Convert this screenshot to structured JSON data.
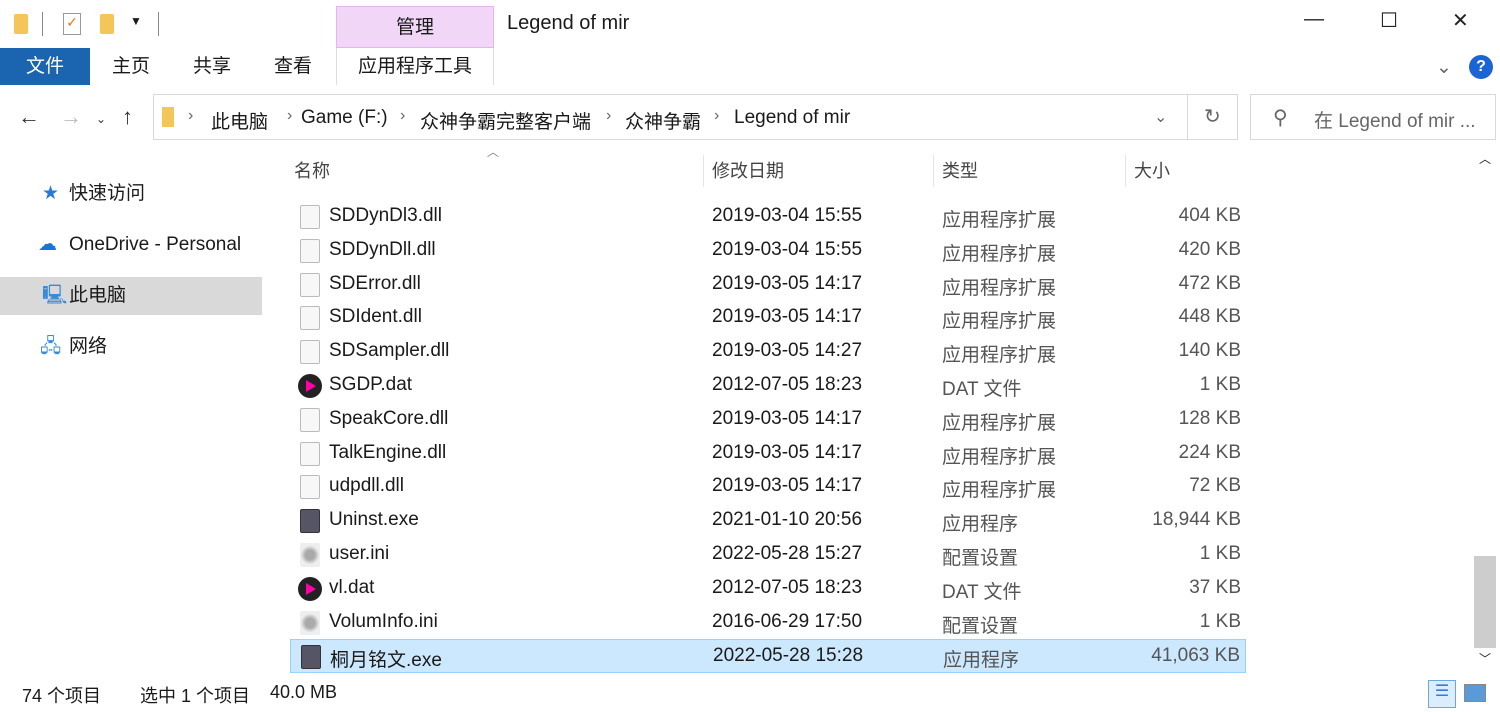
{
  "window": {
    "title": "Legend of mir",
    "context_tab_group": "管理"
  },
  "ribbon": {
    "tabs": [
      "文件",
      "主页",
      "共享",
      "查看",
      "应用程序工具"
    ]
  },
  "address": {
    "crumbs": [
      "此电脑",
      "Game (F:)",
      "众神争霸完整客户端",
      "众神争霸",
      "Legend of mir"
    ]
  },
  "search": {
    "placeholder": "在 Legend of mir ..."
  },
  "sidebar": {
    "items": [
      {
        "label": "快速访问",
        "icon": "star-icon"
      },
      {
        "label": "OneDrive - Personal",
        "icon": "cloud-icon"
      },
      {
        "label": "此电脑",
        "icon": "computer-icon",
        "selected": true
      },
      {
        "label": "网络",
        "icon": "network-icon"
      }
    ]
  },
  "columns": {
    "name": "名称",
    "date": "修改日期",
    "type": "类型",
    "size": "大小"
  },
  "files": [
    {
      "name": "SDDynDl3.dll",
      "date": "2019-03-04 15:55",
      "type": "应用程序扩展",
      "size": "404 KB",
      "icon": "dll"
    },
    {
      "name": "SDDynDll.dll",
      "date": "2019-03-04 15:55",
      "type": "应用程序扩展",
      "size": "420 KB",
      "icon": "dll"
    },
    {
      "name": "SDError.dll",
      "date": "2019-03-05 14:17",
      "type": "应用程序扩展",
      "size": "472 KB",
      "icon": "dll"
    },
    {
      "name": "SDIdent.dll",
      "date": "2019-03-05 14:17",
      "type": "应用程序扩展",
      "size": "448 KB",
      "icon": "dll"
    },
    {
      "name": "SDSampler.dll",
      "date": "2019-03-05 14:27",
      "type": "应用程序扩展",
      "size": "140 KB",
      "icon": "dll"
    },
    {
      "name": "SGDP.dat",
      "date": "2012-07-05 18:23",
      "type": "DAT 文件",
      "size": "1 KB",
      "icon": "dat"
    },
    {
      "name": "SpeakCore.dll",
      "date": "2019-03-05 14:17",
      "type": "应用程序扩展",
      "size": "128 KB",
      "icon": "dll"
    },
    {
      "name": "TalkEngine.dll",
      "date": "2019-03-05 14:17",
      "type": "应用程序扩展",
      "size": "224 KB",
      "icon": "dll"
    },
    {
      "name": "udpdll.dll",
      "date": "2019-03-05 14:17",
      "type": "应用程序扩展",
      "size": "72 KB",
      "icon": "dll"
    },
    {
      "name": "Uninst.exe",
      "date": "2021-01-10 20:56",
      "type": "应用程序",
      "size": "18,944 KB",
      "icon": "exe"
    },
    {
      "name": "user.ini",
      "date": "2022-05-28 15:27",
      "type": "配置设置",
      "size": "1 KB",
      "icon": "ini"
    },
    {
      "name": "vl.dat",
      "date": "2012-07-05 18:23",
      "type": "DAT 文件",
      "size": "37 KB",
      "icon": "dat"
    },
    {
      "name": "VolumInfo.ini",
      "date": "2016-06-29 17:50",
      "type": "配置设置",
      "size": "1 KB",
      "icon": "ini"
    },
    {
      "name": "桐月铭文.exe",
      "date": "2022-05-28 15:28",
      "type": "应用程序",
      "size": "41,063 KB",
      "icon": "exe",
      "selected": true
    }
  ],
  "status": {
    "count": "74 个项目",
    "selection": "选中 1 个项目",
    "size": "40.0 MB"
  },
  "colors": {
    "file_tab": "#1a64b0",
    "context_tab": "#f1d6f7",
    "selection": "#cce8ff"
  }
}
